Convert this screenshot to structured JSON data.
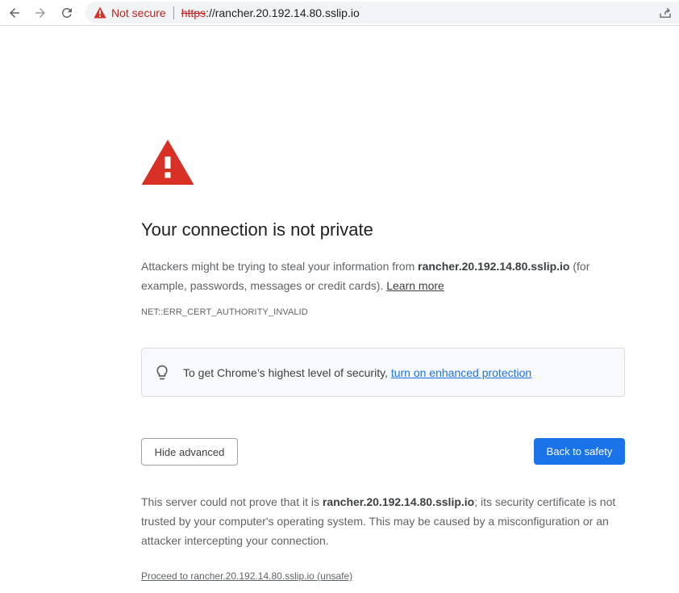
{
  "browser": {
    "security_label": "Not secure",
    "url_scheme": "https",
    "url_rest": "://rancher.20.192.14.80.sslip.io",
    "icons": {
      "back": "arrow-left-icon",
      "forward": "arrow-right-icon",
      "reload": "reload-icon",
      "security": "warning-triangle-icon",
      "share": "share-icon"
    }
  },
  "interstitial": {
    "title": "Your connection is not private",
    "explanation": {
      "before_host": "Attackers might be trying to steal your information from ",
      "host": "rancher.20.192.14.80.sslip.io",
      "after_host": " (for example, passwords, messages or credit cards). ",
      "learn_more": "Learn more"
    },
    "error_code": "NET::ERR_CERT_AUTHORITY_INVALID",
    "enhanced_protection": {
      "text": "To get Chrome’s highest level of security, ",
      "link": "turn on enhanced protection"
    },
    "hide_advanced_label": "Hide advanced",
    "back_to_safety_label": "Back to safety",
    "details": {
      "before_host": "This server could not prove that it is ",
      "host": "rancher.20.192.14.80.sslip.io",
      "after_host": "; its security certificate is not trusted by your computer's operating system. This may be caused by a misconfiguration or an attacker intercepting your connection."
    },
    "proceed_link": "Proceed to rancher.20.192.14.80.sslip.io (unsafe)"
  },
  "colors": {
    "danger_red": "#d93025",
    "primary_blue": "#1a73e8",
    "text_gray": "#5f6368"
  }
}
